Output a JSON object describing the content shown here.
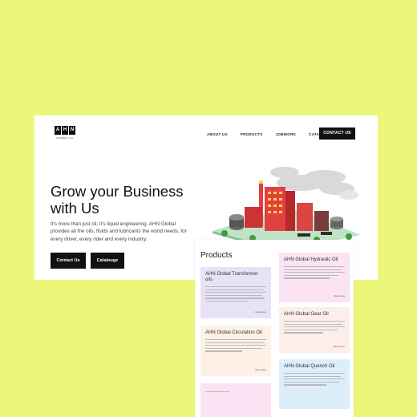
{
  "logo": {
    "letters": [
      "A",
      "H",
      "N"
    ],
    "tagline": "GLOBAL LLC"
  },
  "nav": {
    "items": [
      "ABOUT US",
      "PRODUCTS",
      "JOBWORK",
      "CATALOGUE"
    ],
    "contact_label": "CONTACT US"
  },
  "hero": {
    "title": "Grow your Business with Us",
    "description": "It's more than just oil, it's liquid engineering. AHN Global provides all the oils, fluids and lubricants the world needs, for every driver, every rider and every industry.",
    "primary_button": "Contact Us",
    "secondary_button": "Catalouge"
  },
  "products": {
    "title": "Products",
    "cards": [
      {
        "name": "AHN Global Transformer oils",
        "color": "#e7e2f8"
      },
      {
        "name": "AHN Global Hydraulic Oil",
        "color": "#fbe3f3"
      },
      {
        "name": "AHN Global Circulation Oil",
        "color": "#fdf1e6"
      },
      {
        "name": "AHN Global Gear Oil",
        "color": "#fdeeea"
      },
      {
        "name": "AHN Global Quench Oil",
        "color": "#ddeefb"
      },
      {
        "name": "",
        "color": "#fbe3f3"
      }
    ],
    "view_more_label": "View more"
  },
  "colors": {
    "background": "#ecf77a",
    "button": "#111111"
  }
}
